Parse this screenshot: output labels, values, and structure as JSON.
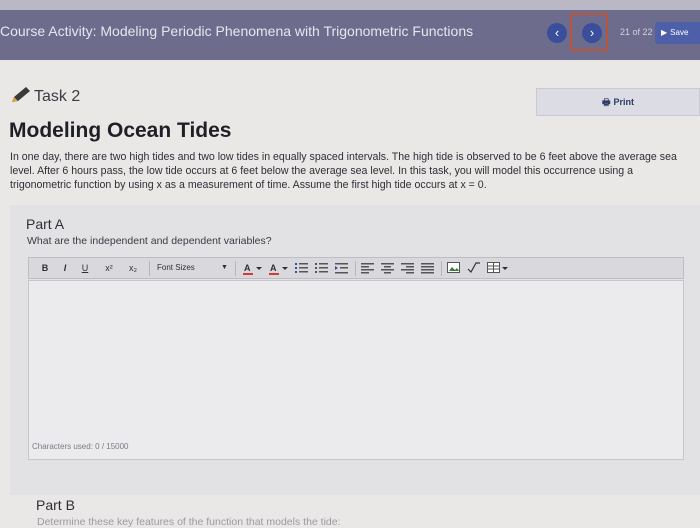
{
  "course": {
    "title": "Course Activity: Modeling Periodic Phenomena with Trigonometric Functions",
    "page_counter": "21 of 22",
    "save_label": "Save"
  },
  "task": {
    "label": "Task 2",
    "print_label": "Print",
    "title": "Modeling Ocean Tides",
    "intro": "In one day, there are two high tides and two low tides in equally spaced intervals. The high tide is observed to be 6 feet above the average sea level. After 6 hours pass, the low tide occurs at 6 feet below the average sea level. In this task, you will model this occurrence using a trigonometric function by using x as a measurement of time. Assume the first high tide occurs at x = 0."
  },
  "part_a": {
    "title": "Part A",
    "question": "What are the independent and dependent variables?",
    "toolbar": {
      "bold": "B",
      "italic": "I",
      "underline": "U",
      "superscript": "x²",
      "subscript": "x₂",
      "font_sizes": "Font Sizes"
    },
    "characters_used": "Characters used: 0 / 15000"
  },
  "part_b": {
    "title": "Part B",
    "question": "Determine these key features of the function that models the tide:"
  },
  "colors": {
    "header_bg": "#6d6c8c",
    "nav_button": "#3a4e9c",
    "highlight_frame": "#b8553a",
    "accent_red": "#d23a3a"
  }
}
